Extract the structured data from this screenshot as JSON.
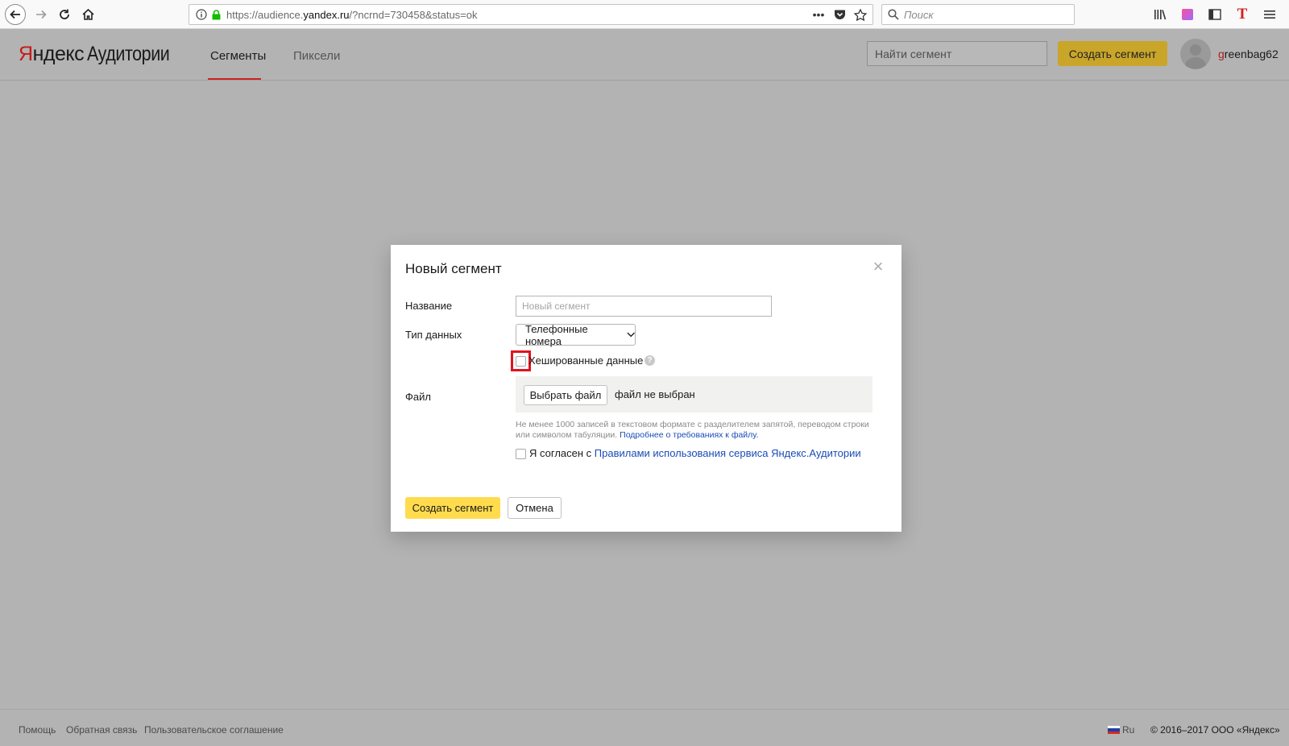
{
  "browser": {
    "url_prefix": "https://audience.",
    "url_domain": "yandex.ru",
    "url_suffix": "/?ncrnd=730458&status=ok",
    "search_placeholder": "Поиск"
  },
  "header": {
    "logo_ya": "Я",
    "logo_rest": "ндекс",
    "logo_product": "Аудитории",
    "tabs": [
      {
        "label": "Сегменты",
        "active": true
      },
      {
        "label": "Пиксели",
        "active": false
      }
    ],
    "find_placeholder": "Найти сегмент",
    "create_button": "Создать сегмент",
    "username_first": "g",
    "username_rest": "reenbag62"
  },
  "modal": {
    "title": "Новый сегмент",
    "name_label": "Название",
    "name_placeholder": "Новый сегмент",
    "type_label": "Тип данных",
    "type_value": "Телефонные номера",
    "hashed_label": "Хешированные данные",
    "help_glyph": "?",
    "file_label": "Файл",
    "file_button": "Выбрать файл",
    "file_status": "файл не выбран",
    "hint_text": "Не менее 1000 записей в текстовом формате с разделителем запятой, переводом строки или символом табуляции.",
    "hint_link": "Подробнее о требованиях к файлу.",
    "agree_text": "Я согласен с",
    "agree_link": "Правилами использования сервиса Яндекс.Аудитории",
    "submit_button": "Создать сегмент",
    "cancel_button": "Отмена",
    "close_glyph": "×"
  },
  "footer": {
    "links": [
      "Помощь",
      "Обратная связь",
      "Пользовательское соглашение"
    ],
    "lang": "Ru",
    "copyright": "© 2016–2017 ООО «Яндекс»"
  },
  "colors": {
    "accent_red": "#c22222",
    "yandex_yellow": "#ffdb4d",
    "link_blue": "#1a4cb8",
    "highlight": "#e0141d"
  }
}
